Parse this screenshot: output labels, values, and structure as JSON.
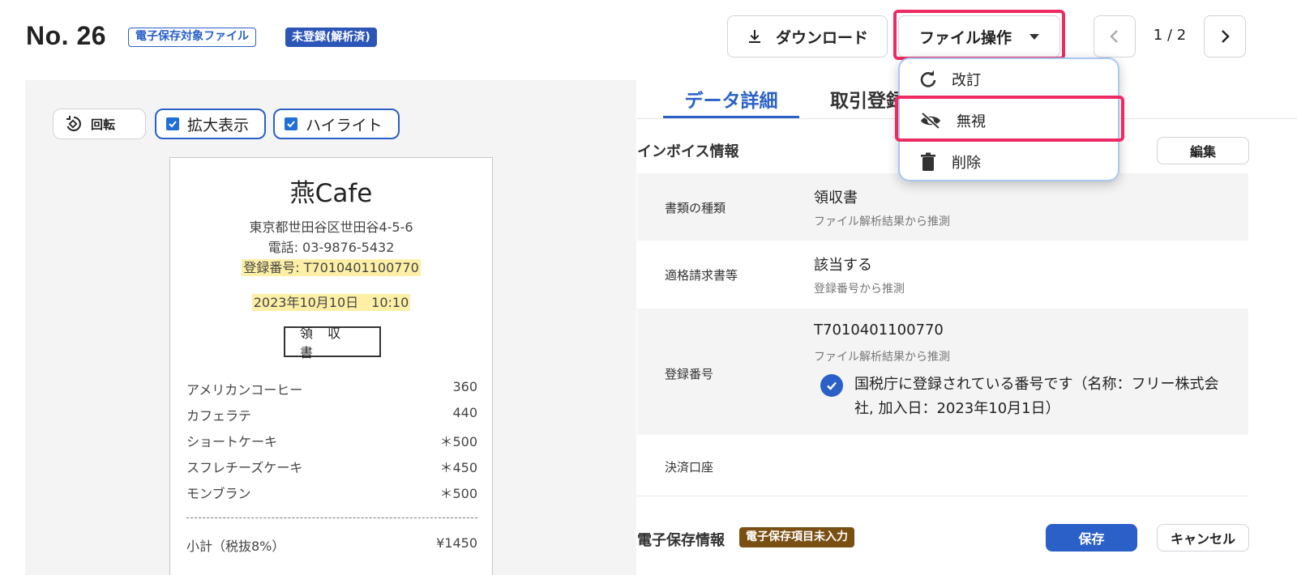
{
  "header": {
    "title": "No. 26",
    "tag_storage": "電子保存対象ファイル",
    "tag_status": "未登録(解析済)",
    "download_label": "ダウンロード",
    "file_ops_label": "ファイル操作",
    "pager": "1 / 2"
  },
  "menu": {
    "items": [
      {
        "label": "改訂",
        "icon": "refresh-icon"
      },
      {
        "label": "無視",
        "icon": "eye-off-icon"
      },
      {
        "label": "削除",
        "icon": "trash-icon"
      }
    ]
  },
  "preview": {
    "rotate_label": "回転",
    "zoom_label": "拡大表示",
    "highlight_label": "ハイライト",
    "receipt": {
      "shop": "燕Cafe",
      "address": "東京都世田谷区世田谷4-5-6",
      "phone": "電話: 03-9876-5432",
      "reg_no": "登録番号: T7010401100770",
      "datetime": "2023年10月10日　10:10",
      "doc_type": "領収書",
      "items": [
        {
          "name": "アメリカンコーヒー",
          "price": "360"
        },
        {
          "name": "カフェラテ",
          "price": "440"
        },
        {
          "name": "ショートケーキ",
          "price": "＊500"
        },
        {
          "name": "スフレチーズケーキ",
          "price": "＊450"
        },
        {
          "name": "モンブラン",
          "price": "＊500"
        }
      ],
      "subtotal_label": "小計（税抜8%）",
      "subtotal_value": "¥1450"
    }
  },
  "detail": {
    "tabs": [
      {
        "label": "データ詳細"
      },
      {
        "label": "取引登録"
      }
    ],
    "invoice_title": "インボイス情報",
    "edit_label": "編集",
    "rows": [
      {
        "label": "書類の種類",
        "value": "領収書",
        "sub": "ファイル解析結果から推測"
      },
      {
        "label": "適格請求書等",
        "value": "該当する",
        "sub": "登録番号から推測"
      },
      {
        "label": "登録番号",
        "value": "T7010401100770",
        "sub": "ファイル解析結果から推測"
      },
      {
        "label": "決済口座",
        "value": "",
        "sub": ""
      }
    ],
    "verify_text": "国税庁に登録されている番号です（名称：フリー株式会社, 加入日：2023年10月1日）",
    "storage_title": "電子保存情報",
    "storage_tag": "電子保存項目未入力",
    "save_label": "保存",
    "cancel_label": "キャンセル"
  }
}
